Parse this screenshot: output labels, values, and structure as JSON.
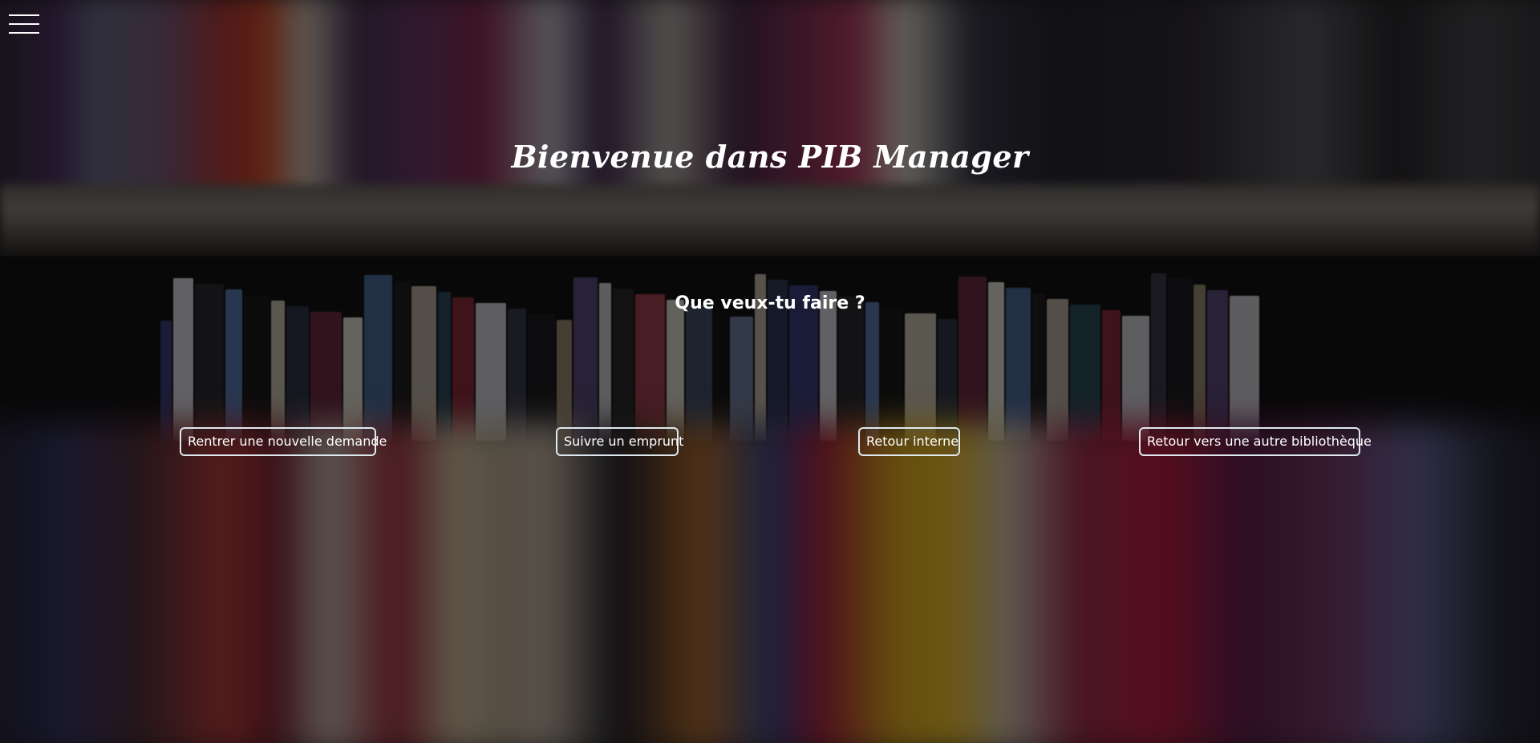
{
  "header": {
    "menu_icon": "hamburger-menu-icon"
  },
  "hero": {
    "title": "Bienvenue dans PIB Manager",
    "question": "Que veux-tu faire ?"
  },
  "actions": [
    {
      "label": "Rentrer une nouvelle demande"
    },
    {
      "label": "Suivre un emprunt"
    },
    {
      "label": "Retour interne"
    },
    {
      "label": "Retour vers une autre bibliothèque"
    }
  ],
  "theme": {
    "text_color": "#ffffff",
    "button_border_color": "#dfe9ef",
    "overlay_color": "rgba(0,0,0,0.55)"
  }
}
